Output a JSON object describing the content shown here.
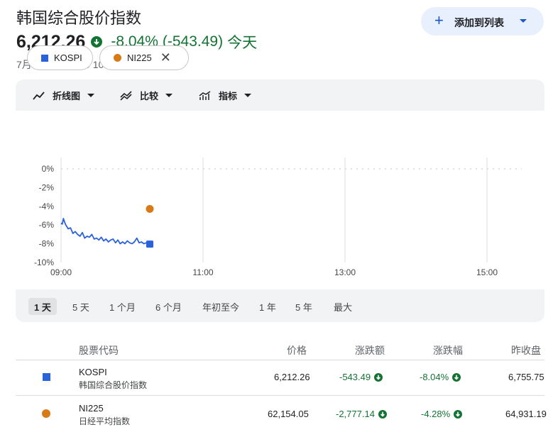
{
  "header": {
    "title": "韩国综合股价指数",
    "price": "6,212.26",
    "change_pct": "-8.04%",
    "change_abs": "(-543.49)",
    "change_period": "今天",
    "timestamp": "7月28日, UTC+9 10:15:40",
    "add_button_label": "添加到列表"
  },
  "toolbar": {
    "line_chart_label": "折线图",
    "compare_label": "比较",
    "indicators_label": "指标"
  },
  "chips": [
    {
      "label": "KOSPI",
      "color": "#2a62d9"
    },
    {
      "label": "NI225",
      "color": "#d87a16"
    }
  ],
  "ranges": [
    "1 天",
    "5 天",
    "1 个月",
    "6 个月",
    "年初至今",
    "1 年",
    "5 年",
    "最大"
  ],
  "active_range": "1 天",
  "chart_data": {
    "type": "line",
    "xlabel": "",
    "ylabel": "",
    "x_ticks": [
      "09:00",
      "11:00",
      "13:00",
      "15:00"
    ],
    "y_ticks": [
      "0%",
      "-2%",
      "-4%",
      "-6%",
      "-8%",
      "-10%"
    ],
    "ylim": [
      -10,
      0
    ],
    "grid": true,
    "series": [
      {
        "name": "KOSPI",
        "color": "#2a62d9",
        "x": [
          "09:00",
          "09:01",
          "09:02",
          "09:03",
          "09:04",
          "09:06",
          "09:08",
          "09:10",
          "09:12",
          "09:14",
          "09:16",
          "09:18",
          "09:20",
          "09:22",
          "09:24",
          "09:26",
          "09:28",
          "09:30",
          "09:32",
          "09:34",
          "09:36",
          "09:38",
          "09:40",
          "09:42",
          "09:44",
          "09:46",
          "09:48",
          "09:50",
          "09:52",
          "09:54",
          "09:56",
          "09:58",
          "10:00",
          "10:02",
          "10:04",
          "10:06",
          "10:08",
          "10:10",
          "10:12",
          "10:14",
          "10:15"
        ],
        "values": [
          -5.8,
          -5.9,
          -5.3,
          -5.7,
          -6.0,
          -6.4,
          -6.3,
          -6.9,
          -6.7,
          -7.0,
          -7.2,
          -6.8,
          -7.4,
          -7.2,
          -7.3,
          -7.0,
          -7.5,
          -7.4,
          -7.6,
          -7.3,
          -7.7,
          -7.5,
          -7.8,
          -7.6,
          -7.5,
          -7.9,
          -7.6,
          -8.0,
          -7.8,
          -8.0,
          -7.7,
          -7.9,
          -8.0,
          -7.8,
          -7.4,
          -7.9,
          -7.8,
          -8.0,
          -7.9,
          -8.0,
          -8.04
        ]
      },
      {
        "name": "NI225",
        "color": "#d87a16",
        "x": [
          "10:15"
        ],
        "values": [
          -4.28
        ]
      }
    ]
  },
  "table": {
    "headers": [
      "股票代码",
      "价格",
      "涨跌额",
      "涨跌幅",
      "昨收盘"
    ],
    "rows": [
      {
        "symbol": "KOSPI",
        "name": "韩国综合股价指数",
        "price": "6,212.26",
        "change": "-543.49",
        "change_pct": "-8.04%",
        "prev_close": "6,755.75"
      },
      {
        "symbol": "NI225",
        "name": "日经平均指数",
        "price": "62,154.05",
        "change": "-2,777.14",
        "change_pct": "-4.28%",
        "prev_close": "64,931.19"
      }
    ]
  }
}
